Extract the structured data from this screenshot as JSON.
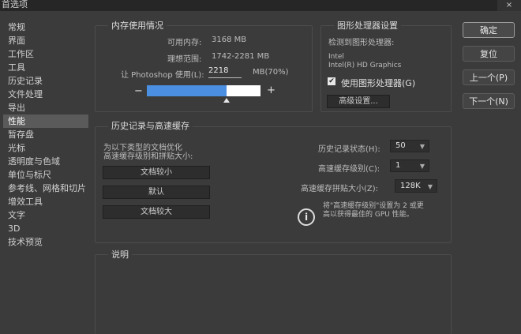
{
  "window": {
    "title": "首选项",
    "close_glyph": "×"
  },
  "sidebar": {
    "items": [
      {
        "label": "常规"
      },
      {
        "label": "界面"
      },
      {
        "label": "工作区"
      },
      {
        "label": "工具"
      },
      {
        "label": "历史记录"
      },
      {
        "label": "文件处理"
      },
      {
        "label": "导出"
      },
      {
        "label": "性能"
      },
      {
        "label": "暂存盘"
      },
      {
        "label": "光标"
      },
      {
        "label": "透明度与色域"
      },
      {
        "label": "单位与标尺"
      },
      {
        "label": "参考线、网格和切片"
      },
      {
        "label": "增效工具"
      },
      {
        "label": "文字"
      },
      {
        "label": "3D"
      },
      {
        "label": "技术预览"
      }
    ],
    "active_index": 7
  },
  "memory": {
    "title": "内存使用情况",
    "available_label": "可用内存:",
    "available_value": "3168 MB",
    "ideal_label": "理想范围:",
    "ideal_value": "1742-2281 MB",
    "let_label": "让 Photoshop 使用(L):",
    "let_value": "2218",
    "let_unit": "MB(70%)",
    "minus": "−",
    "plus": "+",
    "usage_fraction": 0.7
  },
  "gpu": {
    "title": "图形处理器设置",
    "detected_label": "检测到图形处理器:",
    "vendor": "Intel",
    "model": "Intel(R) HD Graphics",
    "use_label": "使用图形处理器(G)",
    "use_checked": true,
    "check_glyph": "✔",
    "advanced_button": "高级设置..."
  },
  "history_cache": {
    "title": "历史记录与高速缓存",
    "optimize_text_1": "为以下类型的文档优化",
    "optimize_text_2": "高速缓存级别和拼贴大小:",
    "preset_buttons": [
      "文档较小",
      "默认",
      "文档较大"
    ],
    "history_states_label": "历史记录状态(H):",
    "history_states_value": "50",
    "cache_levels_label": "高速缓存级别(C):",
    "cache_levels_value": "1",
    "tile_size_label": "高速缓存拼贴大小(Z):",
    "tile_size_value": "128K",
    "info_glyph": "i",
    "hint_line1": "将\"高速缓存级别\"设置为 2 或更",
    "hint_line2": "高以获得最佳的 GPU 性能。"
  },
  "description": {
    "title": "说明"
  },
  "dialog_buttons": {
    "ok": "确定",
    "reset": "复位",
    "prev": "上一个(P)",
    "next": "下一个(N)"
  },
  "colors": {
    "accent_slider": "#4a8fe2",
    "background": "#3b3b3b"
  }
}
